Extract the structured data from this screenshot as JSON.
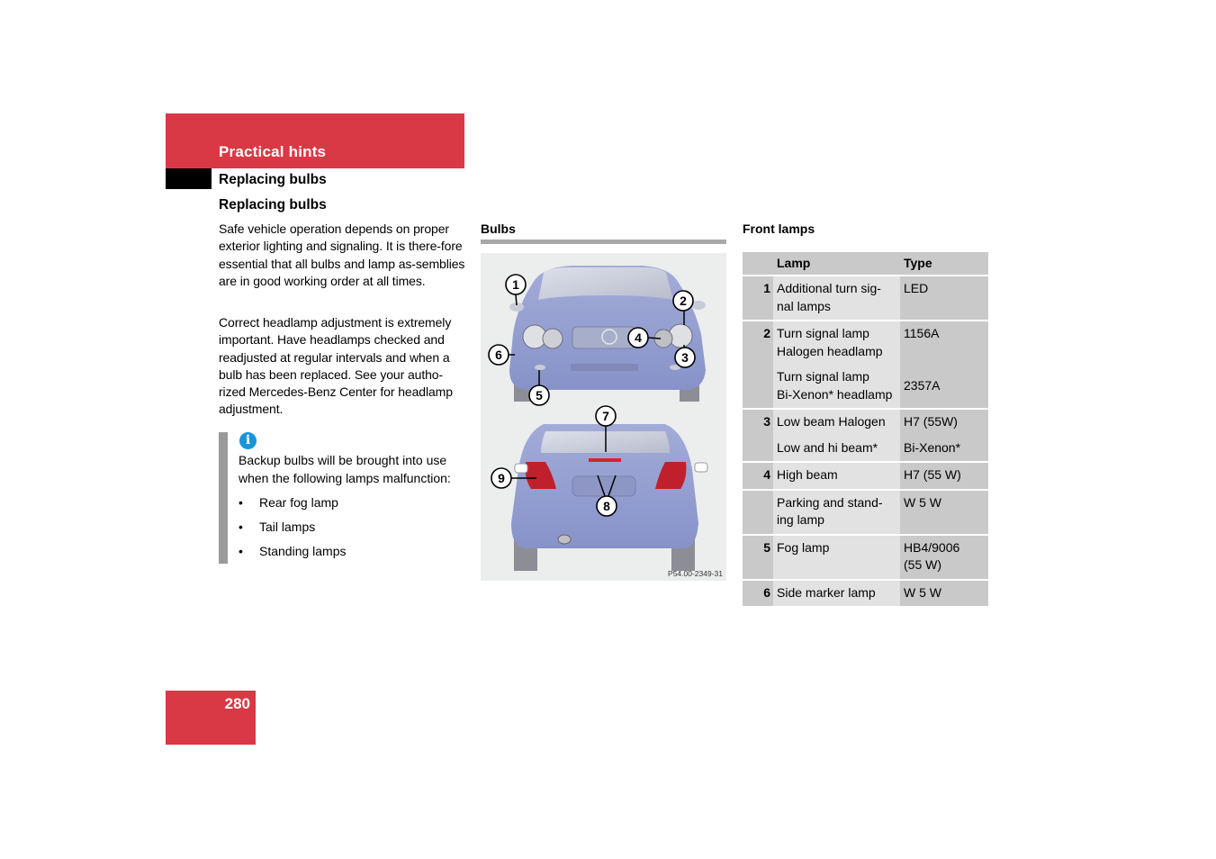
{
  "header": {
    "section": "Practical hints",
    "subsection": "Replacing bulbs",
    "title": "Replacing bulbs"
  },
  "intro": {
    "paragraph1": "Safe vehicle operation depends on proper exterior lighting and signaling. It is there-fore essential that all bulbs and lamp as-semblies are in good working order at all times.",
    "paragraph2": "Correct headlamp adjustment is extremely important. Have headlamps checked and readjusted at regular intervals and when a bulb has been replaced. See your autho-rized Mercedes-Benz Center for headlamp adjustment."
  },
  "info": {
    "icon": "info-icon",
    "text": "Backup bulbs will be brought into use when the following lamps malfunction:",
    "items": [
      "Rear fog lamp",
      "Tail lamps",
      "Standing lamps"
    ],
    "bullet": "•"
  },
  "figure": {
    "heading": "Bulbs",
    "code": "P54.00-2349-31",
    "callouts": [
      "1",
      "2",
      "3",
      "4",
      "5",
      "6",
      "7",
      "8",
      "9"
    ],
    "colors": {
      "car_body": "#8f9bd0",
      "tail_lamp": "#c0202c",
      "background": "#eceeed"
    }
  },
  "front_lamps": {
    "heading": "Front lamps",
    "columns": [
      "",
      "Lamp",
      "Type"
    ],
    "rows": [
      {
        "num": "1",
        "lamp": "Additional turn sig-\nnal lamps",
        "type": "LED"
      },
      {
        "num": "2",
        "lamp": "Turn signal lamp\nHalogen headlamp",
        "type": "1156A"
      },
      {
        "num": "",
        "lamp": "Turn signal lamp\nBi-Xenon* headlamp",
        "type": "2357A"
      },
      {
        "num": "3",
        "lamp": "Low beam Halogen",
        "type": "H7 (55W)"
      },
      {
        "num": "",
        "lamp": "Low and hi beam*",
        "type": "Bi-Xenon*"
      },
      {
        "num": "4",
        "lamp": "High beam",
        "type": "H7 (55 W)"
      },
      {
        "num": "",
        "lamp": "Parking and stand-\ning lamp",
        "type": "W 5 W"
      },
      {
        "num": "5",
        "lamp": "Fog lamp",
        "type": "HB4/9006\n(55 W)"
      },
      {
        "num": "6",
        "lamp": "Side marker lamp",
        "type": "W 5 W"
      }
    ]
  },
  "footer": {
    "page_number": "280"
  },
  "theme": {
    "accent": "#d93945",
    "info_blue": "#1a93d8",
    "table_dark": "#c9c9c9",
    "table_light": "#e2e2e2"
  }
}
